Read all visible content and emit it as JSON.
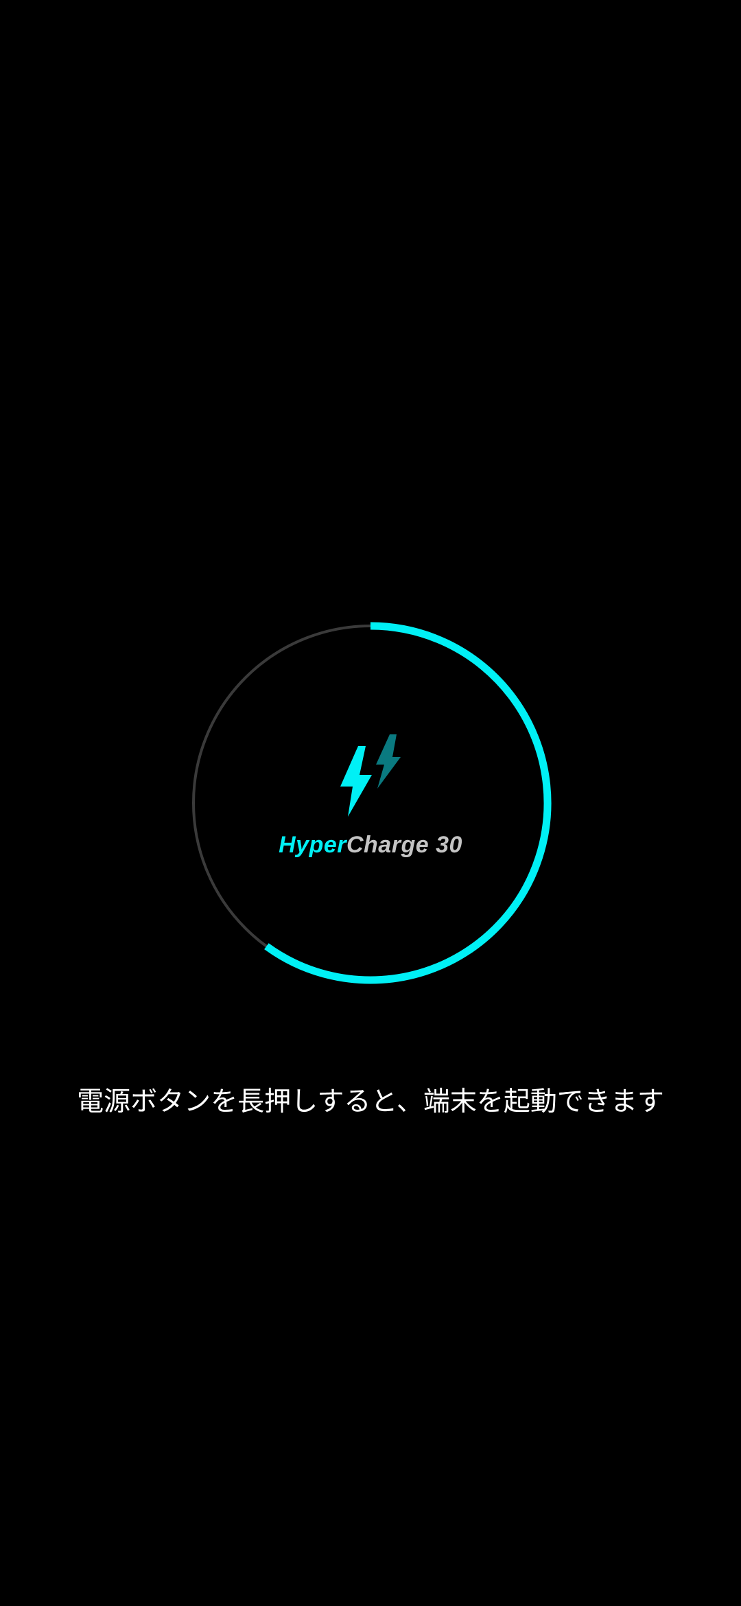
{
  "charging": {
    "progress_fraction": 0.6,
    "brand_primary": "Hyper",
    "brand_secondary": "Charge 30",
    "icon": "double-lightning-bolt-icon"
  },
  "hint": {
    "text": "電源ボタンを長押しすると、端末を起動できます"
  },
  "colors": {
    "background": "#000000",
    "accent": "#00f0f5",
    "accent_dim": "#0a7a80",
    "ring_track": "#3a3a3a",
    "brand_secondary": "#c4c4c4",
    "hint_text": "#ffffff"
  }
}
